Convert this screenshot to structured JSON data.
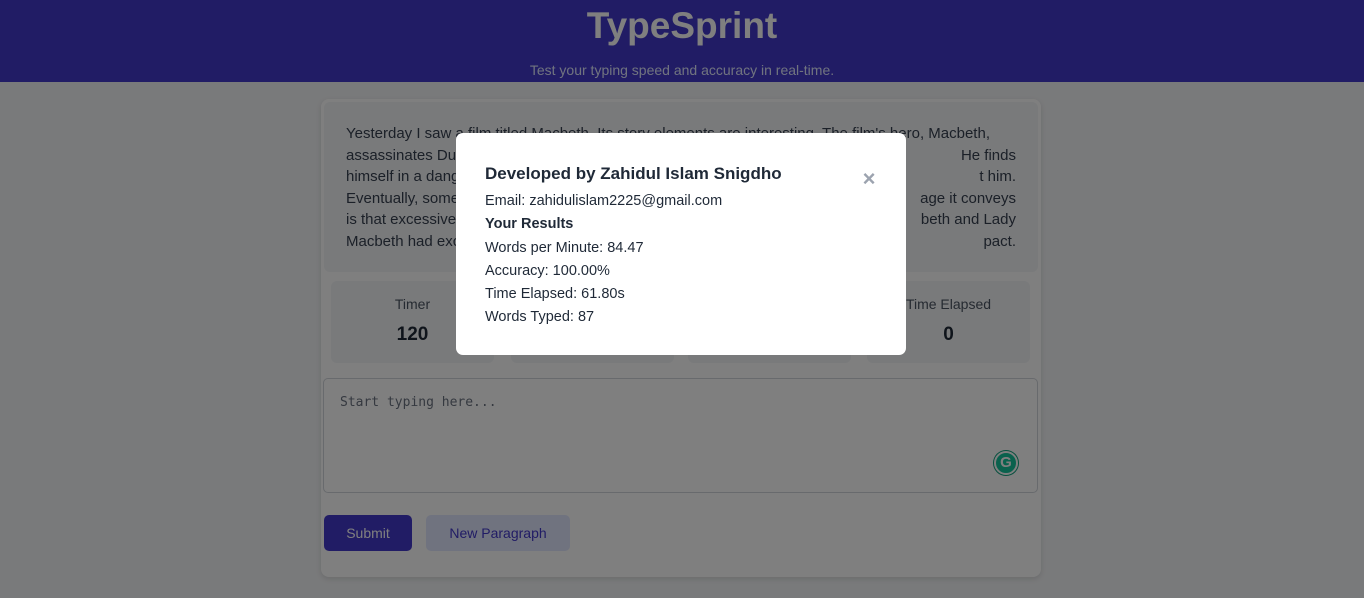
{
  "header": {
    "title": "TypeSprint",
    "subtitle": "Test your typing speed and accuracy in real-time."
  },
  "paragraph": {
    "lines": [
      "Yesterday I saw a film titled Macbeth. Its story elements are interesting. The film's hero, Macbeth,",
      "assassinates Du",
      "himself in a dang",
      "Eventually, some",
      "is that excessive",
      "Macbeth had exc"
    ],
    "right_fragments": [
      "He finds",
      "t him.",
      "age it conveys",
      "beth and Lady",
      "pact."
    ]
  },
  "stats": [
    {
      "label": "Timer",
      "value": "120"
    },
    {
      "label": "",
      "value": ""
    },
    {
      "label": "",
      "value": ""
    },
    {
      "label": "Time Elapsed",
      "value": "0"
    }
  ],
  "typing": {
    "placeholder": "Start typing here...",
    "value": ""
  },
  "buttons": {
    "submit": "Submit",
    "new_paragraph": "New Paragraph"
  },
  "modal": {
    "title": "Developed by Zahidul Islam Snigdho",
    "email": "Email: zahidulislam2225@gmail.com",
    "results_heading": "Your Results",
    "wpm": "Words per Minute: 84.47",
    "accuracy": "Accuracy: 100.00%",
    "time_elapsed": "Time Elapsed: 61.80s",
    "words_typed": "Words Typed: 87",
    "close": "×"
  },
  "colors": {
    "primary": "#4338ca",
    "overlay": "rgba(0,0,0,0.5)"
  },
  "icons": {
    "grammarly": "G"
  }
}
